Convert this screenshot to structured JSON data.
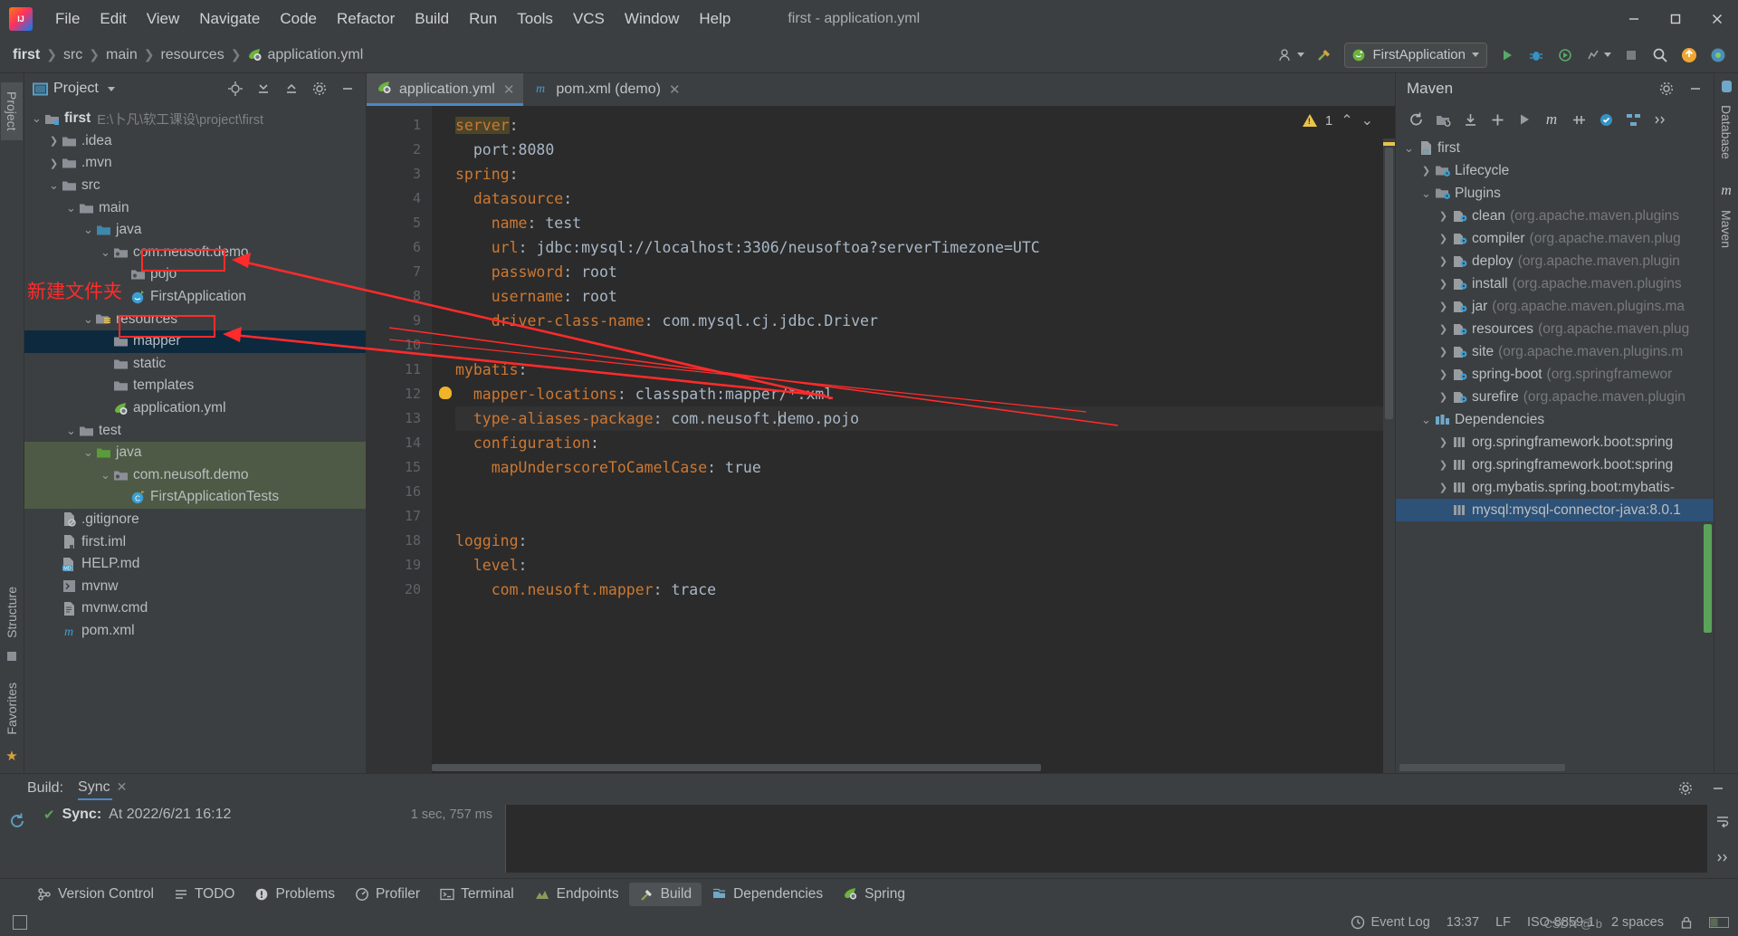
{
  "window": {
    "title": "first - application.yml",
    "logo_icon": "intellij-logo-icon",
    "minimize_icon": "minimize-icon",
    "maximize_icon": "maximize-icon",
    "close_icon": "close-icon"
  },
  "menu": [
    "File",
    "Edit",
    "View",
    "Navigate",
    "Code",
    "Refactor",
    "Build",
    "Run",
    "Tools",
    "VCS",
    "Window",
    "Help"
  ],
  "navbar": {
    "breadcrumbs": [
      "first",
      "src",
      "main",
      "resources",
      "application.yml"
    ],
    "file_icon": "spring-yaml-icon",
    "run_config": "FirstApplication",
    "run_config_icon": "spring-boot-icon",
    "icons": [
      "user-account-icon",
      "hammer-build-icon",
      "run-icon",
      "debug-icon",
      "run-with-coverage-icon",
      "profiler-icon",
      "stop-icon",
      "search-icon",
      "update-icon",
      "ide-eye-icon"
    ]
  },
  "left_tool_tabs": [
    "Project",
    "Structure",
    "Favorites"
  ],
  "right_tool_tabs": [
    "Database",
    "Maven"
  ],
  "project_panel": {
    "title": "Project",
    "dropdown_icon": "chevron-down-icon",
    "header_icons": [
      "locate-icon",
      "expand-all-icon",
      "collapse-all-icon",
      "settings-gear-icon",
      "hide-icon"
    ],
    "tree": [
      {
        "depth": 0,
        "arrow": "down",
        "icon": "module-folder-icon",
        "label": "first",
        "bold": true,
        "path": "E:\\卜凡\\软工课设\\project\\first"
      },
      {
        "depth": 1,
        "arrow": "right",
        "icon": "folder-icon",
        "label": ".idea"
      },
      {
        "depth": 1,
        "arrow": "right",
        "icon": "folder-icon",
        "label": ".mvn"
      },
      {
        "depth": 1,
        "arrow": "down",
        "icon": "folder-icon",
        "label": "src"
      },
      {
        "depth": 2,
        "arrow": "down",
        "icon": "folder-icon",
        "label": "main"
      },
      {
        "depth": 3,
        "arrow": "down",
        "icon": "source-folder-icon",
        "label": "java"
      },
      {
        "depth": 4,
        "arrow": "down",
        "icon": "package-icon",
        "label": "com.neusoft.demo"
      },
      {
        "depth": 5,
        "arrow": "none",
        "icon": "package-icon",
        "label": "pojo",
        "highlight": "red-box"
      },
      {
        "depth": 5,
        "arrow": "none",
        "icon": "spring-class-icon",
        "label": "FirstApplication"
      },
      {
        "depth": 3,
        "arrow": "down",
        "icon": "resource-folder-icon",
        "label": "resources"
      },
      {
        "depth": 4,
        "arrow": "none",
        "icon": "folder-icon",
        "label": "mapper",
        "selected": "blue",
        "highlight": "red-box"
      },
      {
        "depth": 4,
        "arrow": "none",
        "icon": "folder-icon",
        "label": "static"
      },
      {
        "depth": 4,
        "arrow": "none",
        "icon": "folder-icon",
        "label": "templates"
      },
      {
        "depth": 4,
        "arrow": "none",
        "icon": "spring-yaml-icon",
        "label": "application.yml"
      },
      {
        "depth": 2,
        "arrow": "down",
        "icon": "folder-icon",
        "label": "test"
      },
      {
        "depth": 3,
        "arrow": "down",
        "icon": "test-source-folder-icon",
        "label": "java",
        "selected": "green"
      },
      {
        "depth": 4,
        "arrow": "down",
        "icon": "package-icon",
        "label": "com.neusoft.demo",
        "selected": "green"
      },
      {
        "depth": 5,
        "arrow": "none",
        "icon": "test-class-icon",
        "label": "FirstApplicationTests",
        "selected": "green"
      },
      {
        "depth": 1,
        "arrow": "none",
        "icon": "gitignore-icon",
        "label": ".gitignore"
      },
      {
        "depth": 1,
        "arrow": "none",
        "icon": "iml-icon",
        "label": "first.iml"
      },
      {
        "depth": 1,
        "arrow": "none",
        "icon": "markdown-icon",
        "label": "HELP.md"
      },
      {
        "depth": 1,
        "arrow": "none",
        "icon": "script-icon",
        "label": "mvnw"
      },
      {
        "depth": 1,
        "arrow": "none",
        "icon": "cmd-icon",
        "label": "mvnw.cmd"
      },
      {
        "depth": 1,
        "arrow": "none",
        "icon": "maven-xml-icon",
        "label": "pom.xml"
      }
    ]
  },
  "annotations": {
    "note": "新建文件夹",
    "color": "#ff2b2b"
  },
  "editor": {
    "tabs": [
      {
        "label": "application.yml",
        "icon": "spring-yaml-icon",
        "active": true,
        "close_icon": "close-icon"
      },
      {
        "label": "pom.xml (demo)",
        "icon": "maven-xml-icon",
        "active": false,
        "close_icon": "close-icon"
      }
    ],
    "warning_count": "1",
    "warning_icon": "warning-triangle-icon",
    "prev_icon": "chevron-up-icon",
    "next_icon": "chevron-down-icon",
    "lines": [
      {
        "n": "1",
        "text": "server:",
        "fold": "none",
        "segments": [
          {
            "t": "server",
            "c": "k",
            "hl": true
          },
          {
            "t": ":",
            "c": "p"
          }
        ]
      },
      {
        "n": "2",
        "text": "  port:8080",
        "fold": "none",
        "segments": [
          {
            "t": "  ",
            "c": "v"
          },
          {
            "t": "port:8080",
            "c": "v"
          }
        ]
      },
      {
        "n": "3",
        "text": "spring:",
        "fold": "minus",
        "segments": [
          {
            "t": "spring",
            "c": "k"
          },
          {
            "t": ":",
            "c": "p"
          }
        ]
      },
      {
        "n": "4",
        "text": "  datasource:",
        "fold": "minus",
        "segments": [
          {
            "t": "  ",
            "c": "v"
          },
          {
            "t": "datasource",
            "c": "k"
          },
          {
            "t": ":",
            "c": "p"
          }
        ]
      },
      {
        "n": "5",
        "text": "    name: test",
        "fold": "none",
        "segments": [
          {
            "t": "    ",
            "c": "v"
          },
          {
            "t": "name",
            "c": "k"
          },
          {
            "t": ": ",
            "c": "p"
          },
          {
            "t": "test",
            "c": "v"
          }
        ]
      },
      {
        "n": "6",
        "text": "    url: jdbc:mysql://localhost:3306/neusoftoa?serverTimezone=UTC",
        "fold": "none",
        "segments": [
          {
            "t": "    ",
            "c": "v"
          },
          {
            "t": "url",
            "c": "k"
          },
          {
            "t": ": ",
            "c": "p"
          },
          {
            "t": "jdbc:mysql://localhost:3306/neusoftoa?serverTimezone=UTC",
            "c": "v"
          }
        ]
      },
      {
        "n": "7",
        "text": "    password: root",
        "fold": "none",
        "segments": [
          {
            "t": "    ",
            "c": "v"
          },
          {
            "t": "password",
            "c": "k"
          },
          {
            "t": ": ",
            "c": "p"
          },
          {
            "t": "root",
            "c": "v"
          }
        ]
      },
      {
        "n": "8",
        "text": "    username: root",
        "fold": "none",
        "segments": [
          {
            "t": "    ",
            "c": "v"
          },
          {
            "t": "username",
            "c": "k"
          },
          {
            "t": ": ",
            "c": "p"
          },
          {
            "t": "root",
            "c": "v"
          }
        ]
      },
      {
        "n": "9",
        "text": "    driver-class-name: com.mysql.cj.jdbc.Driver",
        "fold": "end",
        "segments": [
          {
            "t": "    ",
            "c": "v"
          },
          {
            "t": "driver-class-name",
            "c": "k"
          },
          {
            "t": ": ",
            "c": "p"
          },
          {
            "t": "com.mysql.cj.jdbc.Driver",
            "c": "v"
          }
        ]
      },
      {
        "n": "10",
        "text": "",
        "fold": "none",
        "segments": []
      },
      {
        "n": "11",
        "text": "mybatis:",
        "fold": "minus",
        "segments": [
          {
            "t": "mybatis",
            "c": "k"
          },
          {
            "t": ":",
            "c": "p"
          }
        ]
      },
      {
        "n": "12",
        "text": "  mapper-locations: classpath:mapper/*.xml",
        "fold": "none",
        "bulb": true,
        "segments": [
          {
            "t": "  ",
            "c": "v"
          },
          {
            "t": "mapper-locations",
            "c": "k"
          },
          {
            "t": ": ",
            "c": "p"
          },
          {
            "t": "classpath:mapper/*.xml",
            "c": "v"
          }
        ]
      },
      {
        "n": "13",
        "text": "  type-aliases-package: com.neusoft.demo.pojo",
        "fold": "none",
        "current": true,
        "segments": [
          {
            "t": "  ",
            "c": "v"
          },
          {
            "t": "type-aliases-package",
            "c": "k"
          },
          {
            "t": ": ",
            "c": "p"
          },
          {
            "t": "com.neusoft.",
            "c": "v"
          },
          {
            "t": "CARET",
            "c": "caret"
          },
          {
            "t": "demo.pojo",
            "c": "v"
          }
        ]
      },
      {
        "n": "14",
        "text": "  configuration:",
        "fold": "minus",
        "segments": [
          {
            "t": "  ",
            "c": "v"
          },
          {
            "t": "configuration",
            "c": "k"
          },
          {
            "t": ":",
            "c": "p"
          }
        ]
      },
      {
        "n": "15",
        "text": "    mapUnderscoreToCamelCase: true",
        "fold": "end",
        "segments": [
          {
            "t": "    ",
            "c": "v"
          },
          {
            "t": "mapUnderscoreToCamelCase",
            "c": "k"
          },
          {
            "t": ": ",
            "c": "p"
          },
          {
            "t": "true",
            "c": "v"
          }
        ]
      },
      {
        "n": "16",
        "text": "",
        "fold": "none",
        "segments": []
      },
      {
        "n": "17",
        "text": "",
        "fold": "none",
        "segments": []
      },
      {
        "n": "18",
        "text": "logging:",
        "fold": "minus",
        "segments": [
          {
            "t": "logging",
            "c": "k"
          },
          {
            "t": ":",
            "c": "p"
          }
        ]
      },
      {
        "n": "19",
        "text": "  level:",
        "fold": "minus",
        "segments": [
          {
            "t": "  ",
            "c": "v"
          },
          {
            "t": "level",
            "c": "k"
          },
          {
            "t": ":",
            "c": "p"
          }
        ]
      },
      {
        "n": "20",
        "text": "    com.neusoft.mapper: trace",
        "fold": "end",
        "segments": [
          {
            "t": "    ",
            "c": "v"
          },
          {
            "t": "com.neusoft.mapper",
            "c": "k"
          },
          {
            "t": ": ",
            "c": "p"
          },
          {
            "t": "trace",
            "c": "v"
          }
        ]
      }
    ]
  },
  "maven_panel": {
    "title": "Maven",
    "header_icons": [
      "settings-gear-icon",
      "hide-icon"
    ],
    "toolbar_icons": [
      "reload-all-icon",
      "add-maven-project-icon",
      "download-sources-icon",
      "add-icon",
      "run-icon",
      "maven-m-icon",
      "skip-tests-icon",
      "toggle-offline-icon",
      "show-diagram-icon",
      "more-icon"
    ],
    "tree": [
      {
        "depth": 0,
        "arrow": "down",
        "icon": "maven-project-icon",
        "label": "first"
      },
      {
        "depth": 1,
        "arrow": "right",
        "icon": "lifecycle-folder-icon",
        "label": "Lifecycle"
      },
      {
        "depth": 1,
        "arrow": "down",
        "icon": "plugins-folder-icon",
        "label": "Plugins"
      },
      {
        "depth": 2,
        "arrow": "right",
        "icon": "plugin-icon",
        "label": "clean",
        "dim": "(org.apache.maven.plugins"
      },
      {
        "depth": 2,
        "arrow": "right",
        "icon": "plugin-icon",
        "label": "compiler",
        "dim": "(org.apache.maven.plug"
      },
      {
        "depth": 2,
        "arrow": "right",
        "icon": "plugin-icon",
        "label": "deploy",
        "dim": "(org.apache.maven.plugin"
      },
      {
        "depth": 2,
        "arrow": "right",
        "icon": "plugin-icon",
        "label": "install",
        "dim": "(org.apache.maven.plugins"
      },
      {
        "depth": 2,
        "arrow": "right",
        "icon": "plugin-icon",
        "label": "jar",
        "dim": "(org.apache.maven.plugins.ma"
      },
      {
        "depth": 2,
        "arrow": "right",
        "icon": "plugin-icon",
        "label": "resources",
        "dim": "(org.apache.maven.plug"
      },
      {
        "depth": 2,
        "arrow": "right",
        "icon": "plugin-icon",
        "label": "site",
        "dim": "(org.apache.maven.plugins.m"
      },
      {
        "depth": 2,
        "arrow": "right",
        "icon": "plugin-icon",
        "label": "spring-boot",
        "dim": "(org.springframewor"
      },
      {
        "depth": 2,
        "arrow": "right",
        "icon": "plugin-icon",
        "label": "surefire",
        "dim": "(org.apache.maven.plugin"
      },
      {
        "depth": 1,
        "arrow": "down",
        "icon": "dependencies-folder-icon",
        "label": "Dependencies"
      },
      {
        "depth": 2,
        "arrow": "right",
        "icon": "library-icon",
        "label": "org.springframework.boot:spring"
      },
      {
        "depth": 2,
        "arrow": "right",
        "icon": "library-icon",
        "label": "org.springframework.boot:spring"
      },
      {
        "depth": 2,
        "arrow": "right",
        "icon": "library-icon",
        "label": "org.mybatis.spring.boot:mybatis-"
      },
      {
        "depth": 2,
        "arrow": "none",
        "icon": "library-icon",
        "label": "mysql:mysql-connector-java:8.0.1",
        "selected": true
      }
    ]
  },
  "build_panel": {
    "label": "Build:",
    "tab": "Sync",
    "tab_close_icon": "close-icon",
    "header_icons": [
      "settings-gear-icon",
      "hide-icon"
    ],
    "side_icons": [
      "rerun-icon"
    ],
    "right_icons": [
      "wrap-text-icon",
      "expand-more-icon"
    ],
    "sync_status_icon": "check-icon",
    "sync_label": "Sync:",
    "sync_text": "At 2022/6/21 16:12",
    "sync_duration": "1 sec, 757 ms"
  },
  "toolstrip": [
    {
      "label": "Version Control",
      "icon": "version-control-icon",
      "active": false
    },
    {
      "label": "TODO",
      "icon": "todo-icon",
      "active": false
    },
    {
      "label": "Problems",
      "icon": "problems-icon",
      "active": false
    },
    {
      "label": "Profiler",
      "icon": "profiler-icon",
      "active": false
    },
    {
      "label": "Terminal",
      "icon": "terminal-icon",
      "active": false
    },
    {
      "label": "Endpoints",
      "icon": "endpoints-icon",
      "active": false
    },
    {
      "label": "Build",
      "icon": "build-hammer-icon",
      "active": true
    },
    {
      "label": "Dependencies",
      "icon": "dependencies-icon",
      "active": false
    },
    {
      "label": "Spring",
      "icon": "spring-leaf-icon",
      "active": false
    }
  ],
  "statusbar": {
    "event_log": "Event Log",
    "event_log_icon": "event-log-icon",
    "time": "13:37",
    "line_separator": "LF",
    "encoding": "ISO-8859-1",
    "indent": "2 spaces",
    "lock_icon": "lock-icon",
    "memory_icon": "memory-icon"
  }
}
